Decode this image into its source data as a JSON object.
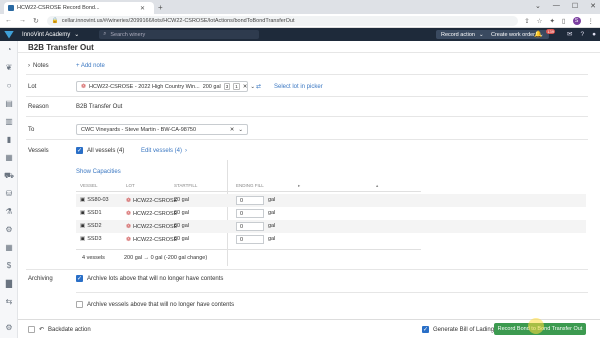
{
  "browser": {
    "tab_title": "HCW22-CSROSE Record Bond...",
    "url": "cellar.innovint.us/#/wineries/2099166/lots/HCW22-CSROSE/lotActions/bondToBondTransferOut"
  },
  "header": {
    "app_name": "InnoVint Academy",
    "search_placeholder": "Search winery",
    "record_action": "Record action",
    "create_work_order": "Create work order",
    "notification_count": "139"
  },
  "page": {
    "title": "B2B Transfer Out",
    "notes": {
      "label": "Notes",
      "add": "+ Add note"
    },
    "lot": {
      "label": "Lot",
      "value": "HCW22-CSROSE - 2022 High Country Win...",
      "volume": "200 gal",
      "count_a": "3",
      "count_b": "1",
      "select_link": "Select lot in picker"
    },
    "reason": {
      "label": "Reason",
      "value": "B2B Transfer Out"
    },
    "to": {
      "label": "To",
      "value": "CWC Vineyards - Steve Martin - BW-CA-98750"
    },
    "vessels": {
      "label": "Vessels",
      "all_label": "All vessels (4)",
      "edit_link": "Edit vessels (4)",
      "show_capacities": "Show Capacities",
      "columns": [
        "Vessel",
        "Lot",
        "Startfill",
        "Ending fill"
      ],
      "rows": [
        {
          "vessel": "SS80-03",
          "lot": "HCW22-CSROSE",
          "start": "20 gal",
          "end": "0",
          "unit": "gal"
        },
        {
          "vessel": "SSD1",
          "lot": "HCW22-CSROSE",
          "start": "60 gal",
          "end": "0",
          "unit": "gal"
        },
        {
          "vessel": "SSD2",
          "lot": "HCW22-CSROSE",
          "start": "60 gal",
          "end": "0",
          "unit": "gal"
        },
        {
          "vessel": "SSD3",
          "lot": "HCW22-CSROSE",
          "start": "60 gal",
          "end": "0",
          "unit": "gal"
        }
      ],
      "summary_count": "4 vessels",
      "summary_change": "200 gal → 0 gal (-200 gal change)"
    },
    "archiving": {
      "label": "Archiving",
      "option1": "Archive lots above that will no longer have contents",
      "option2": "Archive vessels above that will no longer have contents"
    }
  },
  "footer": {
    "backdate": "Backdate action",
    "bill_of_lading": "Generate Bill of Lading",
    "submit": "Record Bond to Bond Transfer Out"
  }
}
